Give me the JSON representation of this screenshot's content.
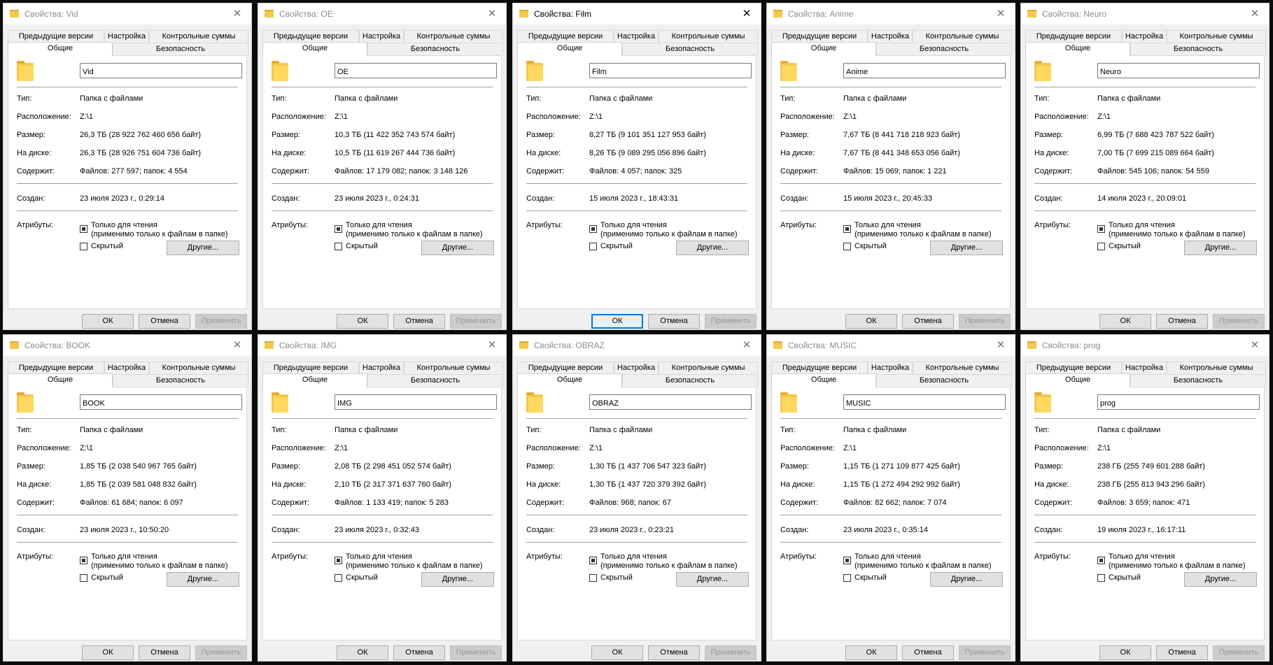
{
  "labels": {
    "type": "Тип:",
    "location": "Расположение:",
    "size": "Размер:",
    "on_disk": "На диске:",
    "contains": "Содержит:",
    "created": "Создан:",
    "attributes": "Атрибуты:",
    "readonly_line1": "Только для чтения",
    "readonly_line2": "(применимо только к файлам в папке)",
    "hidden": "Скрытый",
    "other_button": "Другие...",
    "ok": "ОК",
    "cancel": "Отмена",
    "apply": "Применить"
  },
  "tabs": {
    "previous": "Предыдущие версии",
    "settings": "Настройка",
    "checksums": "Контрольные суммы",
    "general": "Общие",
    "security": "Безопасность"
  },
  "colors": {
    "folder": "#f6c74d",
    "focus": "#0078d7"
  },
  "dialogs": [
    {
      "title": "Свойства: Vid",
      "name": "Vid",
      "type": "Папка с файлами",
      "location": "Z:\\1",
      "size": "26,3 ТБ (28 922 762 460 656 байт)",
      "on_disk": "26,3 ТБ (28 926 751 604 736 байт)",
      "contains": "Файлов: 277 597; папок: 4 554",
      "created": "23 июля 2023 г., 0:29:14"
    },
    {
      "title": "Свойства: OE",
      "name": "OE",
      "type": "Папка с файлами",
      "location": "Z:\\1",
      "size": "10,3 ТБ (11 422 352 743 574 байт)",
      "on_disk": "10,5 ТБ (11 619 267 444 736 байт)",
      "contains": "Файлов: 17 179 082; папок: 3 148 126",
      "created": "23 июля 2023 г., 0:24:31"
    },
    {
      "title": "Свойства: Film",
      "name": "Film",
      "type": "Папка с файлами",
      "location": "Z:\\1",
      "size": "8,27 ТБ (9 101 351 127 953 байт)",
      "on_disk": "8,26 ТБ (9 089 295 056 896 байт)",
      "contains": "Файлов: 4 057; папок: 325",
      "created": "15 июля 2023 г., 18:43:31"
    },
    {
      "title": "Свойства: Anime",
      "name": "Anime",
      "type": "Папка с файлами",
      "location": "Z:\\1",
      "size": "7,67 ТБ (8 441 718 218 923 байт)",
      "on_disk": "7,67 ТБ (8 441 348 653 056 байт)",
      "contains": "Файлов: 15 069; папок: 1 221",
      "created": "15 июля 2023 г., 20:45:33"
    },
    {
      "title": "Свойства: Neuro",
      "name": "Neuro",
      "type": "Папка с файлами",
      "location": "Z:\\1",
      "size": "6,99 ТБ (7 688 423 787 522 байт)",
      "on_disk": "7,00 ТБ (7 699 215 089 664 байт)",
      "contains": "Файлов: 545 106; папок: 54 559",
      "created": "14 июля 2023 г., 20:09:01"
    },
    {
      "title": "Свойства: BOOK",
      "name": "BOOK",
      "type": "Папка с файлами",
      "location": "Z:\\1",
      "size": "1,85 ТБ (2 038 540 967 765 байт)",
      "on_disk": "1,85 ТБ (2 039 581 048 832 байт)",
      "contains": "Файлов: 61 684; папок: 6 097",
      "created": "23 июля 2023 г., 10:50:20"
    },
    {
      "title": "Свойства: IMG",
      "name": "IMG",
      "type": "Папка с файлами",
      "location": "Z:\\1",
      "size": "2,08 ТБ (2 298 451 052 574 байт)",
      "on_disk": "2,10 ТБ (2 317 371 637 760 байт)",
      "contains": "Файлов: 1 133 419; папок: 5 283",
      "created": "23 июля 2023 г., 0:32:43"
    },
    {
      "title": "Свойства: OBRAZ",
      "name": "OBRAZ",
      "type": "Папка с файлами",
      "location": "Z:\\1",
      "size": "1,30 ТБ (1 437 706 547 323 байт)",
      "on_disk": "1,30 ТБ (1 437 720 379 392 байт)",
      "contains": "Файлов: 968; папок: 67",
      "created": "23 июля 2023 г., 0:23:21"
    },
    {
      "title": "Свойства: MUSIC",
      "name": "MUSIC",
      "type": "Папка с файлами",
      "location": "Z:\\1",
      "size": "1,15 ТБ (1 271 109 877 425 байт)",
      "on_disk": "1,15 ТБ (1 272 494 292 992 байт)",
      "contains": "Файлов: 82 662; папок: 7 074",
      "created": "23 июля 2023 г., 0:35:14"
    },
    {
      "title": "Свойства: prog",
      "name": "prog",
      "type": "Папка с файлами",
      "location": "Z:\\1",
      "size": "238 ГБ (255 749 601 288 байт)",
      "on_disk": "238 ГБ (255 813 943 296 байт)",
      "contains": "Файлов: 3 659; папок: 471",
      "created": "19 июля 2023 г., 16:17:11"
    }
  ]
}
